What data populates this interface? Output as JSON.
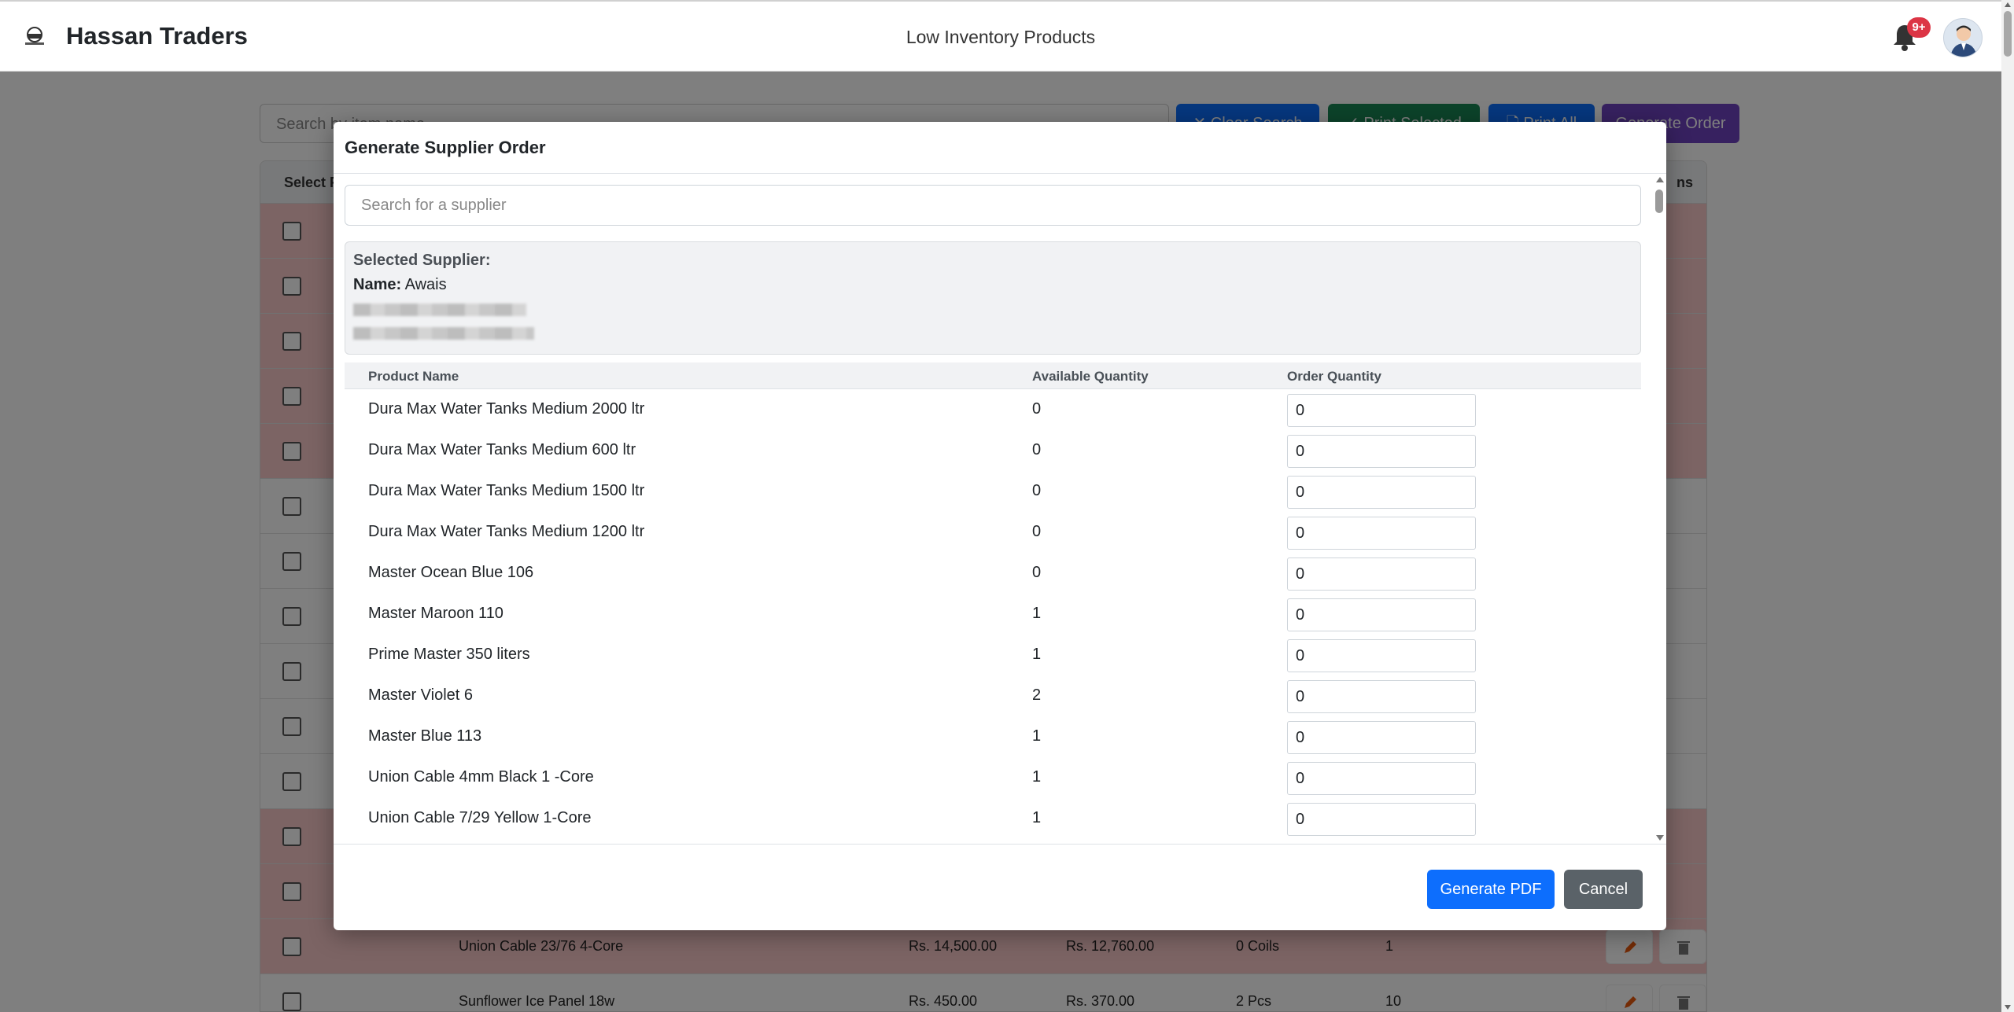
{
  "navbar": {
    "brand": "Hassan Traders",
    "page_title": "Low Inventory Products",
    "notification_badge": "9+"
  },
  "toolbar": {
    "search_placeholder": "Search by item name",
    "clear_search": "✕ Clear Search",
    "print_selected": "✓ Print Selected",
    "print_all": "🗋 Print All",
    "generate_order": "Generate Order"
  },
  "background_table": {
    "headers": [
      "Select P",
      "ns"
    ],
    "visible_rows": [
      {
        "name": "Union Cable 23/76 4-Core",
        "price": "Rs. 14,500.00",
        "cost": "Rs. 12,760.00",
        "stock": "0 Coils",
        "min": "1"
      },
      {
        "name": "Sunflower Ice Panel 18w",
        "price": "Rs. 450.00",
        "cost": "Rs. 370.00",
        "stock": "2 Pcs",
        "min": "10"
      }
    ]
  },
  "modal": {
    "title": "Generate Supplier Order",
    "supplier_search_placeholder": "Search for a supplier",
    "selected_supplier_heading": "Selected Supplier:",
    "name_label": "Name:",
    "name_value": "Awais",
    "columns": {
      "product": "Product Name",
      "available": "Available Quantity",
      "order": "Order Quantity"
    },
    "products": [
      {
        "name": "Dura Max Water Tanks Medium 2000 ltr",
        "available": "0",
        "order": "0"
      },
      {
        "name": "Dura Max Water Tanks Medium 600 ltr",
        "available": "0",
        "order": "0"
      },
      {
        "name": "Dura Max Water Tanks Medium 1500 ltr",
        "available": "0",
        "order": "0"
      },
      {
        "name": "Dura Max Water Tanks Medium 1200 ltr",
        "available": "0",
        "order": "0"
      },
      {
        "name": "Master Ocean Blue 106",
        "available": "0",
        "order": "0"
      },
      {
        "name": "Master Maroon 110",
        "available": "1",
        "order": "0"
      },
      {
        "name": "Prime Master 350 liters",
        "available": "1",
        "order": "0"
      },
      {
        "name": "Master Violet 6",
        "available": "2",
        "order": "0"
      },
      {
        "name": "Master Blue 113",
        "available": "1",
        "order": "0"
      },
      {
        "name": "Union Cable 4mm Black 1 -Core",
        "available": "1",
        "order": "0"
      },
      {
        "name": "Union Cable 7/29 Yellow 1-Core",
        "available": "1",
        "order": "0"
      }
    ],
    "generate_pdf": "Generate PDF",
    "cancel": "Cancel"
  },
  "colors": {
    "primary": "#0d6efd",
    "secondary": "#5a6268",
    "danger": "#dc3545",
    "low_stock_row": "#f8c9c9",
    "purple": "#6f42c1",
    "green": "#198754"
  }
}
